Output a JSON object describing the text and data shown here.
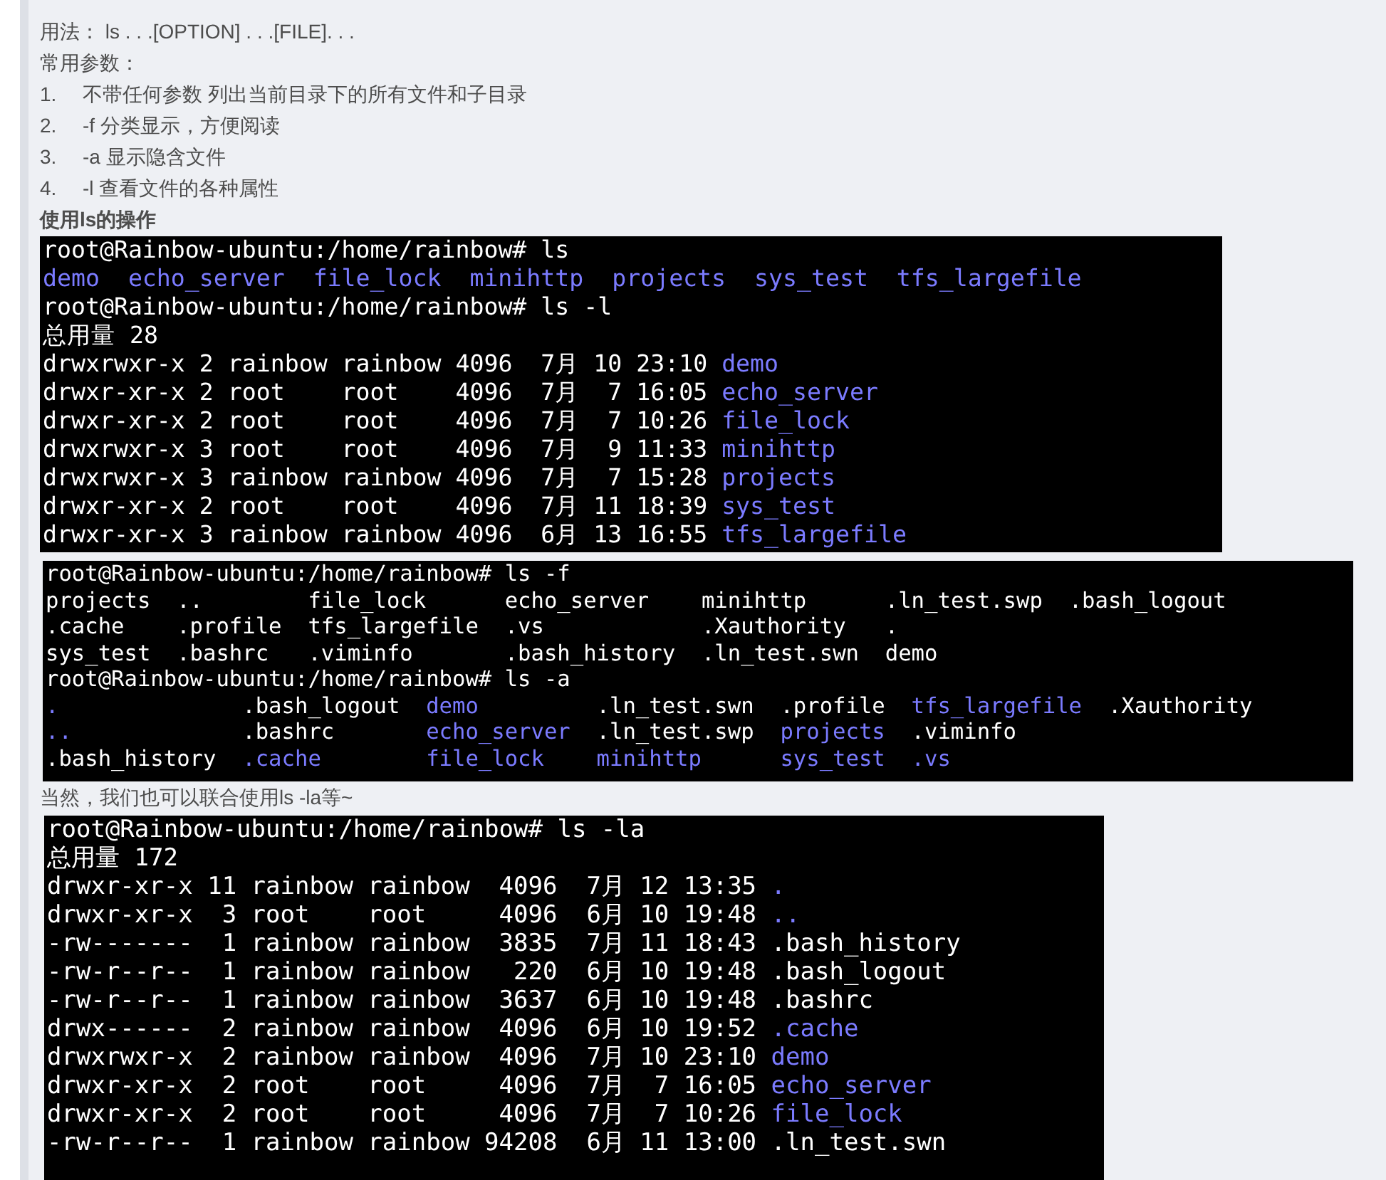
{
  "blocks": [
    {
      "kind": "text",
      "text": "用法： ls . . .[OPTION] . . .[FILE]. . ."
    },
    {
      "kind": "text",
      "text": "常用参数："
    },
    {
      "kind": "list_item",
      "number": "1.",
      "text": "不带任何参数 列出当前目录下的所有文件和子目录"
    },
    {
      "kind": "list_item",
      "number": "2.",
      "text": "-f 分类显示，方便阅读"
    },
    {
      "kind": "list_item",
      "number": "3.",
      "text": "-a 显示隐含文件"
    },
    {
      "kind": "list_item",
      "number": "4.",
      "text": "-l 查看文件的各种属性"
    },
    {
      "kind": "heading",
      "text": "使用ls的操作"
    },
    {
      "kind": "terminal",
      "lines": [
        {
          "kind": "text",
          "text": "root@Rainbow-ubuntu:/home/rainbow# ls"
        },
        {
          "kind": "columns",
          "cells": [
            {
              "text": "demo",
              "dir": true
            },
            {
              "text": "echo_server",
              "dir": true
            },
            {
              "text": "file_lock",
              "dir": true
            },
            {
              "text": "minihttp",
              "dir": true
            },
            {
              "text": "projects",
              "dir": true
            },
            {
              "text": "sys_test",
              "dir": true
            },
            {
              "text": "tfs_largefile",
              "dir": true
            }
          ]
        },
        {
          "kind": "text",
          "text": "root@Rainbow-ubuntu:/home/rainbow# ls -l"
        },
        {
          "kind": "text",
          "text": "总用量 28"
        },
        {
          "kind": "listing",
          "meta": "drwxrwxr-x 2 rainbow rainbow 4096  7月 10 23:10",
          "name": "demo",
          "dir": true
        },
        {
          "kind": "listing",
          "meta": "drwxr-xr-x 2 root    root    4096  7月  7 16:05",
          "name": "echo_server",
          "dir": true
        },
        {
          "kind": "listing",
          "meta": "drwxr-xr-x 2 root    root    4096  7月  7 10:26",
          "name": "file_lock",
          "dir": true
        },
        {
          "kind": "listing",
          "meta": "drwxrwxr-x 3 root    root    4096  7月  9 11:33",
          "name": "minihttp",
          "dir": true
        },
        {
          "kind": "listing",
          "meta": "drwxrwxr-x 3 rainbow rainbow 4096  7月  7 15:28",
          "name": "projects",
          "dir": true
        },
        {
          "kind": "listing",
          "meta": "drwxr-xr-x 2 root    root    4096  7月 11 18:39",
          "name": "sys_test",
          "dir": true
        },
        {
          "kind": "listing",
          "meta": "drwxr-xr-x 3 rainbow rainbow 4096  6月 13 16:55",
          "name": "tfs_largefile",
          "dir": true
        }
      ]
    },
    {
      "kind": "terminal",
      "lines": [
        {
          "kind": "text",
          "text": "root@Rainbow-ubuntu:/home/rainbow# ls -f"
        },
        {
          "kind": "grid",
          "rows": [
            [
              {
                "text": "projects",
                "dir": false
              },
              {
                "text": "..",
                "dir": false
              },
              {
                "text": "file_lock",
                "dir": false
              },
              {
                "text": "echo_server",
                "dir": false
              },
              {
                "text": "minihttp",
                "dir": false
              },
              {
                "text": ".ln_test.swp",
                "dir": false
              },
              {
                "text": ".bash_logout",
                "dir": false
              }
            ],
            [
              {
                "text": ".cache",
                "dir": false
              },
              {
                "text": ".profile",
                "dir": false
              },
              {
                "text": "tfs_largefile",
                "dir": false
              },
              {
                "text": ".vs",
                "dir": false
              },
              {
                "text": ".Xauthority",
                "dir": false
              },
              {
                "text": ".",
                "dir": false
              }
            ],
            [
              {
                "text": "sys_test",
                "dir": false
              },
              {
                "text": ".bashrc",
                "dir": false
              },
              {
                "text": ".viminfo",
                "dir": false
              },
              {
                "text": ".bash_history",
                "dir": false
              },
              {
                "text": ".ln_test.swn",
                "dir": false
              },
              {
                "text": "demo",
                "dir": false
              }
            ]
          ]
        },
        {
          "kind": "text",
          "text": "root@Rainbow-ubuntu:/home/rainbow# ls -a"
        },
        {
          "kind": "grid",
          "rows": [
            [
              {
                "text": ".",
                "dir": true
              },
              {
                "text": ".bash_logout",
                "dir": false
              },
              {
                "text": "demo",
                "dir": true
              },
              {
                "text": ".ln_test.swn",
                "dir": false
              },
              {
                "text": ".profile",
                "dir": false
              },
              {
                "text": "tfs_largefile",
                "dir": true
              },
              {
                "text": ".Xauthority",
                "dir": false
              }
            ],
            [
              {
                "text": "..",
                "dir": true
              },
              {
                "text": ".bashrc",
                "dir": false
              },
              {
                "text": "echo_server",
                "dir": true
              },
              {
                "text": ".ln_test.swp",
                "dir": false
              },
              {
                "text": "projects",
                "dir": true
              },
              {
                "text": ".viminfo",
                "dir": false
              }
            ],
            [
              {
                "text": ".bash_history",
                "dir": false
              },
              {
                "text": ".cache",
                "dir": true
              },
              {
                "text": "file_lock",
                "dir": true
              },
              {
                "text": "minihttp",
                "dir": true
              },
              {
                "text": "sys_test",
                "dir": true
              },
              {
                "text": ".vs",
                "dir": true
              }
            ]
          ]
        }
      ]
    },
    {
      "kind": "text",
      "text": "当然，我们也可以联合使用ls -la等~"
    },
    {
      "kind": "terminal",
      "lines": [
        {
          "kind": "text",
          "text": "root@Rainbow-ubuntu:/home/rainbow# ls -la"
        },
        {
          "kind": "text",
          "text": "总用量 172"
        },
        {
          "kind": "listing",
          "meta": "drwxr-xr-x 11 rainbow rainbow  4096  7月 12 13:35",
          "name": ".",
          "dir": true
        },
        {
          "kind": "listing",
          "meta": "drwxr-xr-x  3 root    root     4096  6月 10 19:48",
          "name": "..",
          "dir": true
        },
        {
          "kind": "listing",
          "meta": "-rw-------  1 rainbow rainbow  3835  7月 11 18:43",
          "name": ".bash_history",
          "dir": false
        },
        {
          "kind": "listing",
          "meta": "-rw-r--r--  1 rainbow rainbow   220  6月 10 19:48",
          "name": ".bash_logout",
          "dir": false
        },
        {
          "kind": "listing",
          "meta": "-rw-r--r--  1 rainbow rainbow  3637  6月 10 19:48",
          "name": ".bashrc",
          "dir": false
        },
        {
          "kind": "listing",
          "meta": "drwx------  2 rainbow rainbow  4096  6月 10 19:52",
          "name": ".cache",
          "dir": true
        },
        {
          "kind": "listing",
          "meta": "drwxrwxr-x  2 rainbow rainbow  4096  7月 10 23:10",
          "name": "demo",
          "dir": true
        },
        {
          "kind": "listing",
          "meta": "drwxr-xr-x  2 root    root     4096  7月  7 16:05",
          "name": "echo_server",
          "dir": true
        },
        {
          "kind": "listing",
          "meta": "drwxr-xr-x  2 root    root     4096  7月  7 10:26",
          "name": "file_lock",
          "dir": true
        },
        {
          "kind": "listing",
          "meta": "-rw-r--r--  1 rainbow rainbow 94208  6月 11 13:00",
          "name": ".ln_test.swn",
          "dir": false
        }
      ]
    }
  ]
}
